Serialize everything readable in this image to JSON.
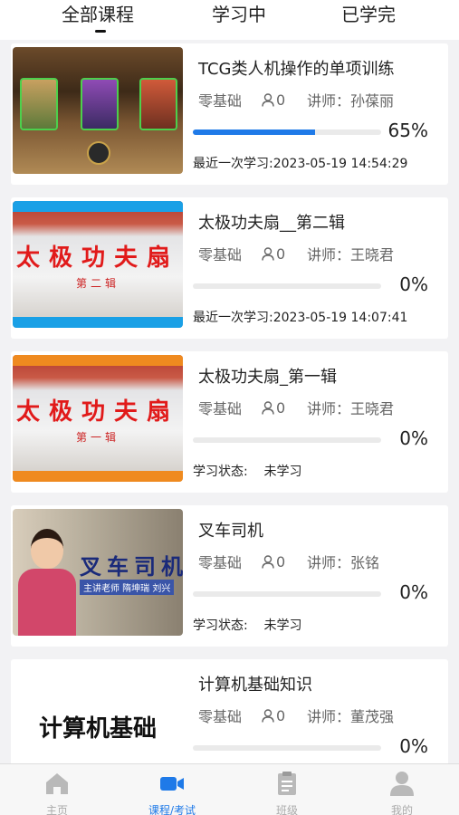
{
  "tabs": [
    {
      "label": "全部课程"
    },
    {
      "label": "学习中"
    },
    {
      "label": "已学完"
    }
  ],
  "courses": [
    {
      "title": "TCG类人机操作的单项训练",
      "level": "零基础",
      "students": "0",
      "teacher": "讲师：孙葆丽",
      "progress": 0.65,
      "progress_text": "65%",
      "footer": "最近一次学习:2023-05-19 14:54:29",
      "thumb_strip": ""
    },
    {
      "title": "太极功夫扇__第二辑",
      "level": "零基础",
      "students": "0",
      "teacher": "讲师：王晓君",
      "progress": 0,
      "progress_text": "0%",
      "footer": "最近一次学习:2023-05-19 14:07:41",
      "thumb_big": "太极功夫扇",
      "thumb_small": "第二辑",
      "band_color": "#1aa0e6"
    },
    {
      "title": "太极功夫扇_第一辑",
      "level": "零基础",
      "students": "0",
      "teacher": "讲师：王晓君",
      "progress": 0,
      "progress_text": "0%",
      "footer": "学习状态:    未学习",
      "thumb_big": "太极功夫扇",
      "thumb_small": "第一辑",
      "band_color": "#ef8a1f"
    },
    {
      "title": "叉车司机",
      "level": "零基础",
      "students": "0",
      "teacher": "讲师：张铭",
      "progress": 0,
      "progress_text": "0%",
      "footer": "学习状态:    未学习",
      "thumb_big": "叉车司机",
      "thumb_small": "主讲老师 隋坤瑞 刘兴"
    },
    {
      "title": "计算机基础知识",
      "level": "零基础",
      "students": "0",
      "teacher": "讲师：董茂强",
      "progress": 0,
      "progress_text": "0%",
      "thumb_big": "计算机基础"
    }
  ],
  "nav": [
    {
      "label": "主页",
      "icon": "home-icon"
    },
    {
      "label": "课程/考试",
      "icon": "video-camera-icon"
    },
    {
      "label": "班级",
      "icon": "clipboard-icon"
    },
    {
      "label": "我的",
      "icon": "user-icon"
    }
  ],
  "colors": {
    "accent": "#1f7ae8",
    "inactive": "#aaaaaa"
  }
}
